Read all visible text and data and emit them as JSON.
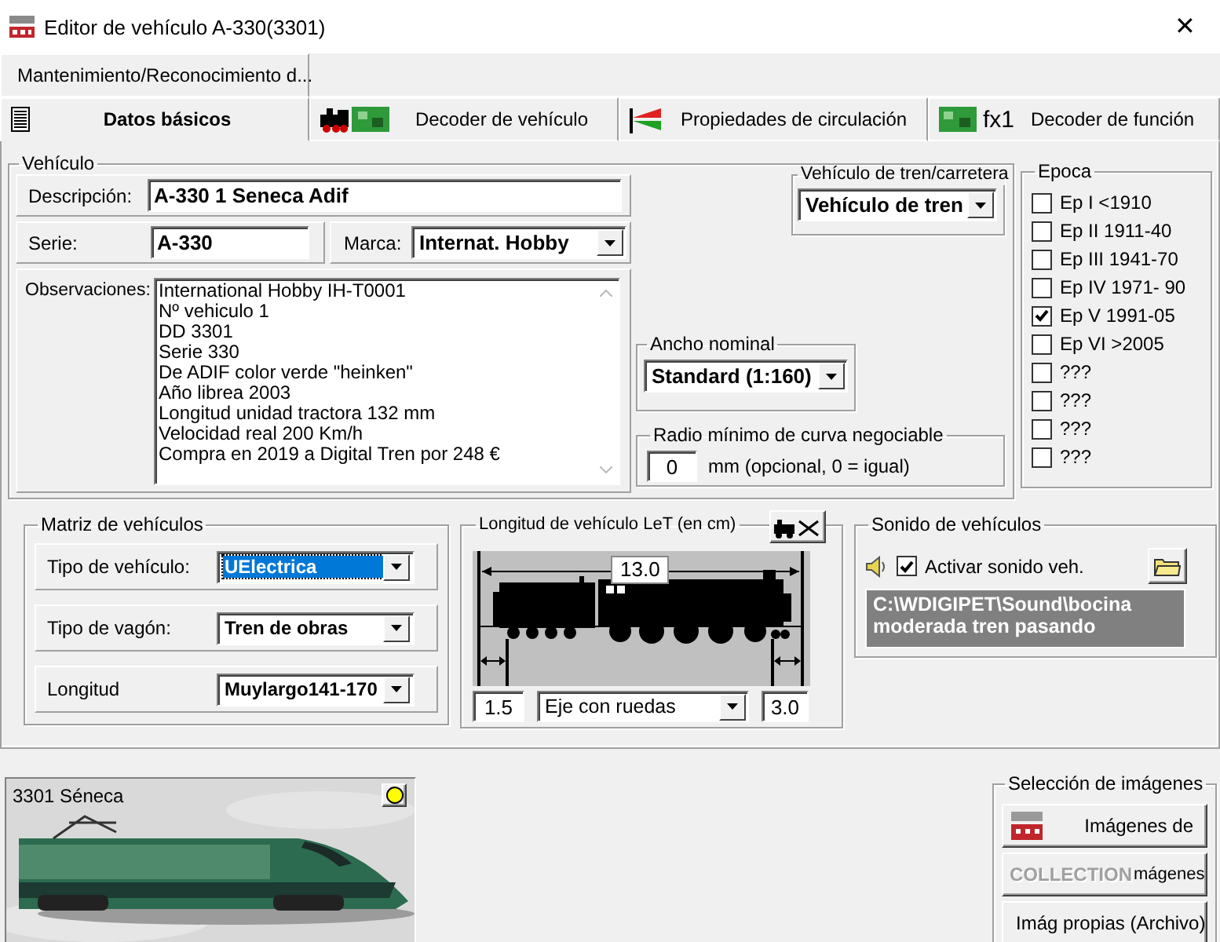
{
  "window": {
    "title": "Editor de vehículo A-330(3301)",
    "close": "✕"
  },
  "tabs_top": [
    {
      "label": "Mantenimiento/Reconocimiento d...",
      "selected": false
    }
  ],
  "tabs": [
    {
      "label": "Datos básicos",
      "selected": true
    },
    {
      "label": "Decoder de vehículo",
      "selected": false
    },
    {
      "label": "Propiedades de circulación",
      "selected": false
    },
    {
      "label": "Decoder de función",
      "badge": "fx1",
      "selected": false
    }
  ],
  "vehicle": {
    "title": "Vehículo",
    "description": {
      "label": "Descripción:",
      "value": "A-330 1 Seneca Adif"
    },
    "series": {
      "label": "Serie:",
      "value": "A-330"
    },
    "brand": {
      "label": "Marca:",
      "value": "Internat. Hobby"
    },
    "notes": {
      "label": "Observaciones:",
      "lines": [
        "International Hobby IH-T0001",
        "Nº vehiculo 1",
        "DD 3301",
        "Serie 330",
        "De ADIF color verde \"heinken\"",
        "Año librea 2003",
        "Longitud unidad tractora 132 mm",
        "Velocidad real 200 Km/h",
        "Compra en 2019 a Digital Tren por 248 €"
      ]
    }
  },
  "rail_road": {
    "title": "Vehículo de tren/carretera",
    "value": "Vehículo de tren"
  },
  "gauge": {
    "title": "Ancho nominal",
    "value": "Standard (1:160)"
  },
  "min_radius": {
    "title": "Radio mínimo de curva negociable",
    "value": "0",
    "unit": "mm (opcional, 0 = igual)"
  },
  "epoch": {
    "title": "Epoca",
    "items": [
      {
        "label": "Ep I <1910",
        "checked": false
      },
      {
        "label": "Ep II 1911-40",
        "checked": false
      },
      {
        "label": "Ep III 1941-70",
        "checked": false
      },
      {
        "label": "Ep IV 1971- 90",
        "checked": false
      },
      {
        "label": "Ep V 1991-05",
        "checked": true
      },
      {
        "label": "Ep VI >2005",
        "checked": false
      },
      {
        "label": "???",
        "checked": false
      },
      {
        "label": "???",
        "checked": false
      },
      {
        "label": "???",
        "checked": false
      },
      {
        "label": "???",
        "checked": false
      }
    ]
  },
  "matrix": {
    "title": "Matriz de vehículos",
    "rows": [
      {
        "label": "Tipo de vehículo:",
        "value": "UElectrica",
        "selected": true
      },
      {
        "label": "Tipo de vagón:",
        "value": "Tren de obras",
        "selected": false
      },
      {
        "label": "Longitud",
        "value": "Muylargo141-170",
        "selected": false
      }
    ]
  },
  "length": {
    "title": "Longitud de vehículo LeT (en cm)",
    "total": "13.0",
    "front": "1.5",
    "mode": "Eje con ruedas",
    "rear": "3.0"
  },
  "sound": {
    "title": "Sonido de vehículos",
    "enable_label": "Activar sonido veh.",
    "enabled": true,
    "path": "C:\\WDIGIPET\\Sound\\bocina moderada tren pasando"
  },
  "picture": {
    "kind": "picture",
    "caption": "3301 Séneca"
  },
  "image_selection": {
    "title": "Selección de imágenes",
    "buttons": [
      {
        "kind": "wdp",
        "label": "Imágenes de"
      },
      {
        "kind": "collection",
        "logo": "COLLECTION",
        "label": "mágenes"
      },
      {
        "kind": "files",
        "label": "Imág propias (Archivo)"
      }
    ]
  }
}
